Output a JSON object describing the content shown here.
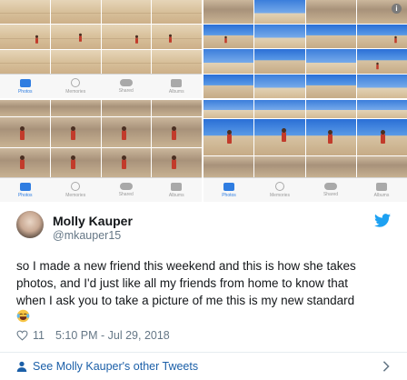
{
  "collage": {
    "tabs": [
      "Photos",
      "Memories",
      "Shared",
      "Albums"
    ],
    "active_tab": "Photos",
    "info_label": "i"
  },
  "tweet": {
    "name": "Molly Kauper",
    "handle": "@mkauper15",
    "text_lines": [
      "so I made a new friend this weekend and this is how she takes",
      "photos, and I'd just like all my friends from home to know that",
      "when I ask you to take a picture of me this is my new standard"
    ],
    "emoji": "😂",
    "likes": "11",
    "timestamp": "5:10 PM - Jul 29, 2018",
    "footer_link": "See Molly Kauper's other Tweets"
  },
  "colors": {
    "twitter_blue": "#1da1f2",
    "link_blue": "#1b5fa8",
    "secondary_text": "#657786",
    "ios_active_tab": "#2f7de1"
  },
  "icons": [
    "info-icon",
    "photos-tab-icon",
    "memories-tab-icon",
    "shared-tab-icon",
    "albums-tab-icon",
    "twitter-bird-icon",
    "heart-icon",
    "person-icon",
    "chevron-right-icon"
  ]
}
